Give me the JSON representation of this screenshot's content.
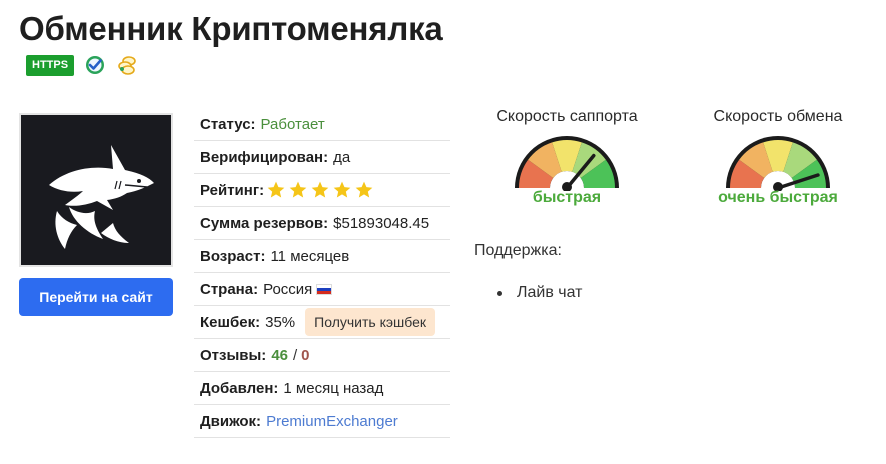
{
  "page": {
    "title": "Обменник Криптоменялка",
    "badges": {
      "https": "HTTPS",
      "verified_icon": "verified-check-icon",
      "coins_icon": "coins-icon"
    }
  },
  "logo": {
    "icon": "shark-logo-icon"
  },
  "site_button": "Перейти на сайт",
  "info": {
    "status": {
      "label": "Статус:",
      "value": "Работает"
    },
    "verified": {
      "label": "Верифицирован:",
      "value": "да"
    },
    "rating": {
      "label": "Рейтинг:",
      "stars": 5,
      "max": 5
    },
    "reserves": {
      "label": "Сумма резервов:",
      "value": "$51893048.45"
    },
    "age": {
      "label": "Возраст:",
      "value": "11 месяцев"
    },
    "country": {
      "label": "Страна:",
      "value": "Россия",
      "flag_icon": "russia-flag-icon"
    },
    "cashback": {
      "label": "Кешбек:",
      "value": "35%",
      "button": "Получить кэшбек"
    },
    "reviews": {
      "label": "Отзывы:",
      "positive": "46",
      "separator": "/",
      "negative": "0"
    },
    "added": {
      "label": "Добавлен:",
      "value": "1 месяц назад"
    },
    "engine": {
      "label": "Движок:",
      "value": "PremiumExchanger"
    }
  },
  "gauges": [
    {
      "title": "Скорость саппорта",
      "value": "быстрая",
      "level": 0.72
    },
    {
      "title": "Скорость обмена",
      "value": "очень быстрая",
      "level": 0.9
    }
  ],
  "support": {
    "title": "Поддержка:",
    "items": [
      "Лайв чат"
    ]
  },
  "colors": {
    "accent_button": "#2d6cf0",
    "https_badge": "#1b9e2e",
    "status_green": "#4a8f3c",
    "link_blue": "#4d7bd1",
    "cashback_button": "#fde6cf",
    "gauge_value_green": "#4caa3c",
    "star_gold": "#f5c518"
  }
}
